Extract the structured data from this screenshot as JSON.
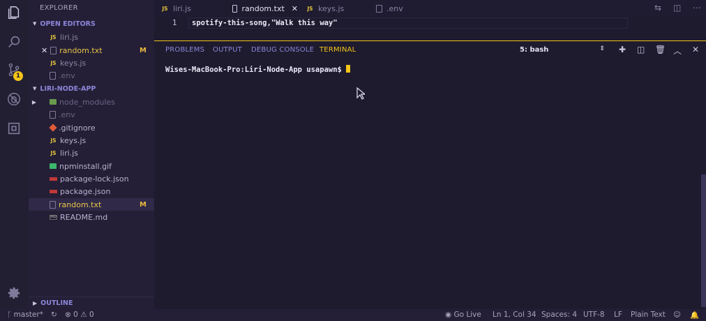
{
  "sidebar": {
    "title": "EXPLORER",
    "open_editors_header": "OPEN EDITORS",
    "open_editors": [
      {
        "name": "liri.js",
        "icon": "js-file-icon",
        "modified": ""
      },
      {
        "name": "random.txt",
        "icon": "text-file-icon",
        "modified": "M"
      },
      {
        "name": "keys.js",
        "icon": "js-file-icon",
        "modified": ""
      },
      {
        "name": ".env",
        "icon": "text-file-icon",
        "modified": ""
      }
    ],
    "project_header": "LIRI-NODE-APP",
    "files": [
      {
        "name": "node_modules",
        "icon": "folder-icon",
        "modified": ""
      },
      {
        "name": ".env",
        "icon": "text-file-icon",
        "modified": ""
      },
      {
        "name": ".gitignore",
        "icon": "git-icon",
        "modified": ""
      },
      {
        "name": "keys.js",
        "icon": "js-file-icon",
        "modified": ""
      },
      {
        "name": "liri.js",
        "icon": "js-file-icon",
        "modified": ""
      },
      {
        "name": "npminstall.gif",
        "icon": "image-icon",
        "modified": ""
      },
      {
        "name": "package-lock.json",
        "icon": "npm-icon",
        "modified": ""
      },
      {
        "name": "package.json",
        "icon": "npm-icon",
        "modified": ""
      },
      {
        "name": "random.txt",
        "icon": "text-file-icon",
        "modified": "M"
      },
      {
        "name": "README.md",
        "icon": "markdown-icon",
        "modified": ""
      }
    ],
    "outline_header": "OUTLINE"
  },
  "activity": {
    "scm_badge": "1"
  },
  "tabs": [
    {
      "label": "liri.js",
      "icon": "js-file-icon"
    },
    {
      "label": "random.txt",
      "icon": "text-file-icon"
    },
    {
      "label": "keys.js",
      "icon": "js-file-icon"
    },
    {
      "label": ".env",
      "icon": "text-file-icon"
    }
  ],
  "editor": {
    "line_number": "1",
    "code": "spotify-this-song,\"Walk this way\""
  },
  "panel": {
    "tabs": [
      "PROBLEMS",
      "OUTPUT",
      "DEBUG CONSOLE",
      "TERMINAL"
    ],
    "terminal_select": "5: bash",
    "prompt": "Wises-MacBook-Pro:Liri-Node-App usapawn$"
  },
  "status": {
    "branch": "master*",
    "errors": "0",
    "warnings": "0",
    "go_live": "Go Live",
    "position": "Ln 1, Col 34",
    "spaces": "Spaces: 4",
    "encoding": "UTF-8",
    "eol": "LF",
    "language": "Plain Text"
  },
  "colors": {
    "accent": "#f5c518",
    "background": "#1e1b2e",
    "sidebar": "#241f36"
  }
}
